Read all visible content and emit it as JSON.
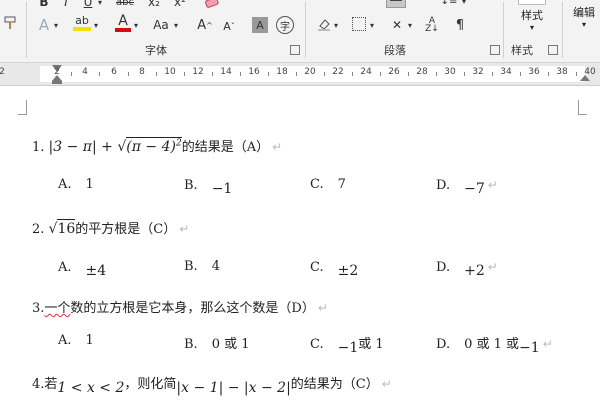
{
  "ribbon": {
    "font_group_label": "字体",
    "paragraph_group_label": "段落",
    "style_group_label": "样式",
    "styles_button": "样式",
    "edit_button": "编辑",
    "font_size_up": "A",
    "font_size_down": "A",
    "change_case": "Aa",
    "char_shading": "A",
    "char_border": "字",
    "font_color_letter": "A",
    "highlight_letter": "ab",
    "bold": "B",
    "italic": "I",
    "underline": "U",
    "strike": "abc",
    "subscript": "x₂",
    "superscript": "x²",
    "accent_red": "#d01010",
    "accent_yellow": "#f3e200",
    "accent_blue": "#2b579a"
  },
  "ruler": {
    "numbers": [
      "2",
      "2",
      "4",
      "6",
      "8",
      "10",
      "12",
      "14",
      "16",
      "18",
      "20",
      "22",
      "24",
      "26",
      "28",
      "30",
      "32",
      "34",
      "36",
      "38",
      "40"
    ]
  },
  "document": {
    "q1": {
      "num": "1.",
      "expr_a": "|3 − π| + ",
      "expr_b": "(π − 4)",
      "exp": "2",
      "text": "的结果是（A）",
      "opts": [
        {
          "label": "A.",
          "value": "1"
        },
        {
          "label": "B.",
          "value": "−1"
        },
        {
          "label": "C.",
          "value": "7"
        },
        {
          "label": "D.",
          "value": "−7"
        }
      ]
    },
    "q2": {
      "num": "2.",
      "rad": "16",
      "text": "的平方根是（C）",
      "opts": [
        {
          "label": "A.",
          "value": "±4"
        },
        {
          "label": "B.",
          "value": "4"
        },
        {
          "label": "C.",
          "value": "±2"
        },
        {
          "label": "D.",
          "value": "+2"
        }
      ]
    },
    "q3": {
      "num": "3.",
      "underlined": "一个",
      "text": "数的立方根是它本身，那么这个数是（D）",
      "opts": [
        {
          "label": "A.",
          "value": "1"
        },
        {
          "label": "B.",
          "value": "0 或 1"
        },
        {
          "label": "C.",
          "value_math": "−1",
          "value_rest": "或 1"
        },
        {
          "label": "D.",
          "value": "0 或 1 或",
          "value_math": "−1"
        }
      ]
    },
    "q4": {
      "num": "4.",
      "pre": "若",
      "cond": "1 < x < 2",
      "mid": "，则化简",
      "expr": "|x − 1| − |x − 2|",
      "text": "的结果为（C）"
    },
    "para_mark": "↵"
  }
}
